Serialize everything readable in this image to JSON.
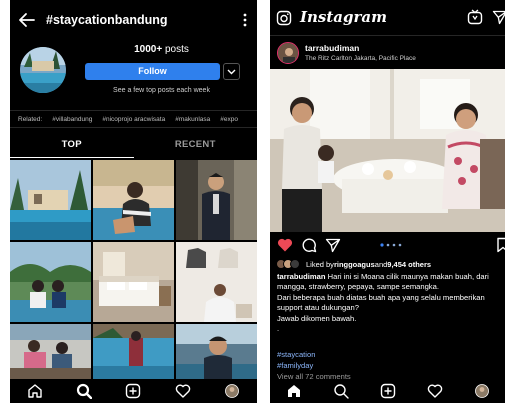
{
  "left": {
    "header": {
      "title": "#staycationbandung"
    },
    "profile": {
      "posts_count": "1000+",
      "posts_label": " posts",
      "follow_label": "Follow",
      "see_few": "See a few top posts each week"
    },
    "related": {
      "label": "Related:",
      "tags": [
        "#villabandung",
        "#nicoprojo aracwisata",
        "#makunlasa",
        "#expo"
      ]
    },
    "tabs": [
      "TOP",
      "RECENT"
    ]
  },
  "right": {
    "header": {
      "logo": "Instagram"
    },
    "post": {
      "username": "tarrabudiman",
      "location": "The Ritz Carlton Jakarta, Pacific Place",
      "liked_prefix": "Liked by ",
      "liked_user": "ringgoagus",
      "liked_mid": " and ",
      "liked_count": "9,454 others",
      "caption_user": "tarrabudiman",
      "caption_text": " Hari ini si Moana cilik maunya makan buah, dari mangga, strawberry, pepaya, sampe semangka.",
      "caption_line2": "Dari beberapa buah  diatas buah apa yang selalu memberikan support atau dukungan?",
      "caption_line3": "Jawab dikomen bawah.",
      "caption_dot": ".",
      "hashtag1": "#staycation",
      "hashtag2": "#familyday",
      "view_all": "View all 72 comments"
    }
  },
  "colors": {
    "background": "#000000",
    "follow_blue": "#2f80ed",
    "like_red": "#ed4956",
    "hashtag_blue": "#8ab4f8",
    "story_ring": "#e1306c"
  },
  "icons": [
    "back-arrow-icon",
    "more-icon",
    "chevron-down-icon",
    "home-icon",
    "search-icon",
    "add-icon",
    "heart-icon",
    "profile-icon",
    "camera-icon",
    "igtv-icon",
    "direct-icon",
    "comment-icon",
    "share-icon",
    "bookmark-icon"
  ]
}
